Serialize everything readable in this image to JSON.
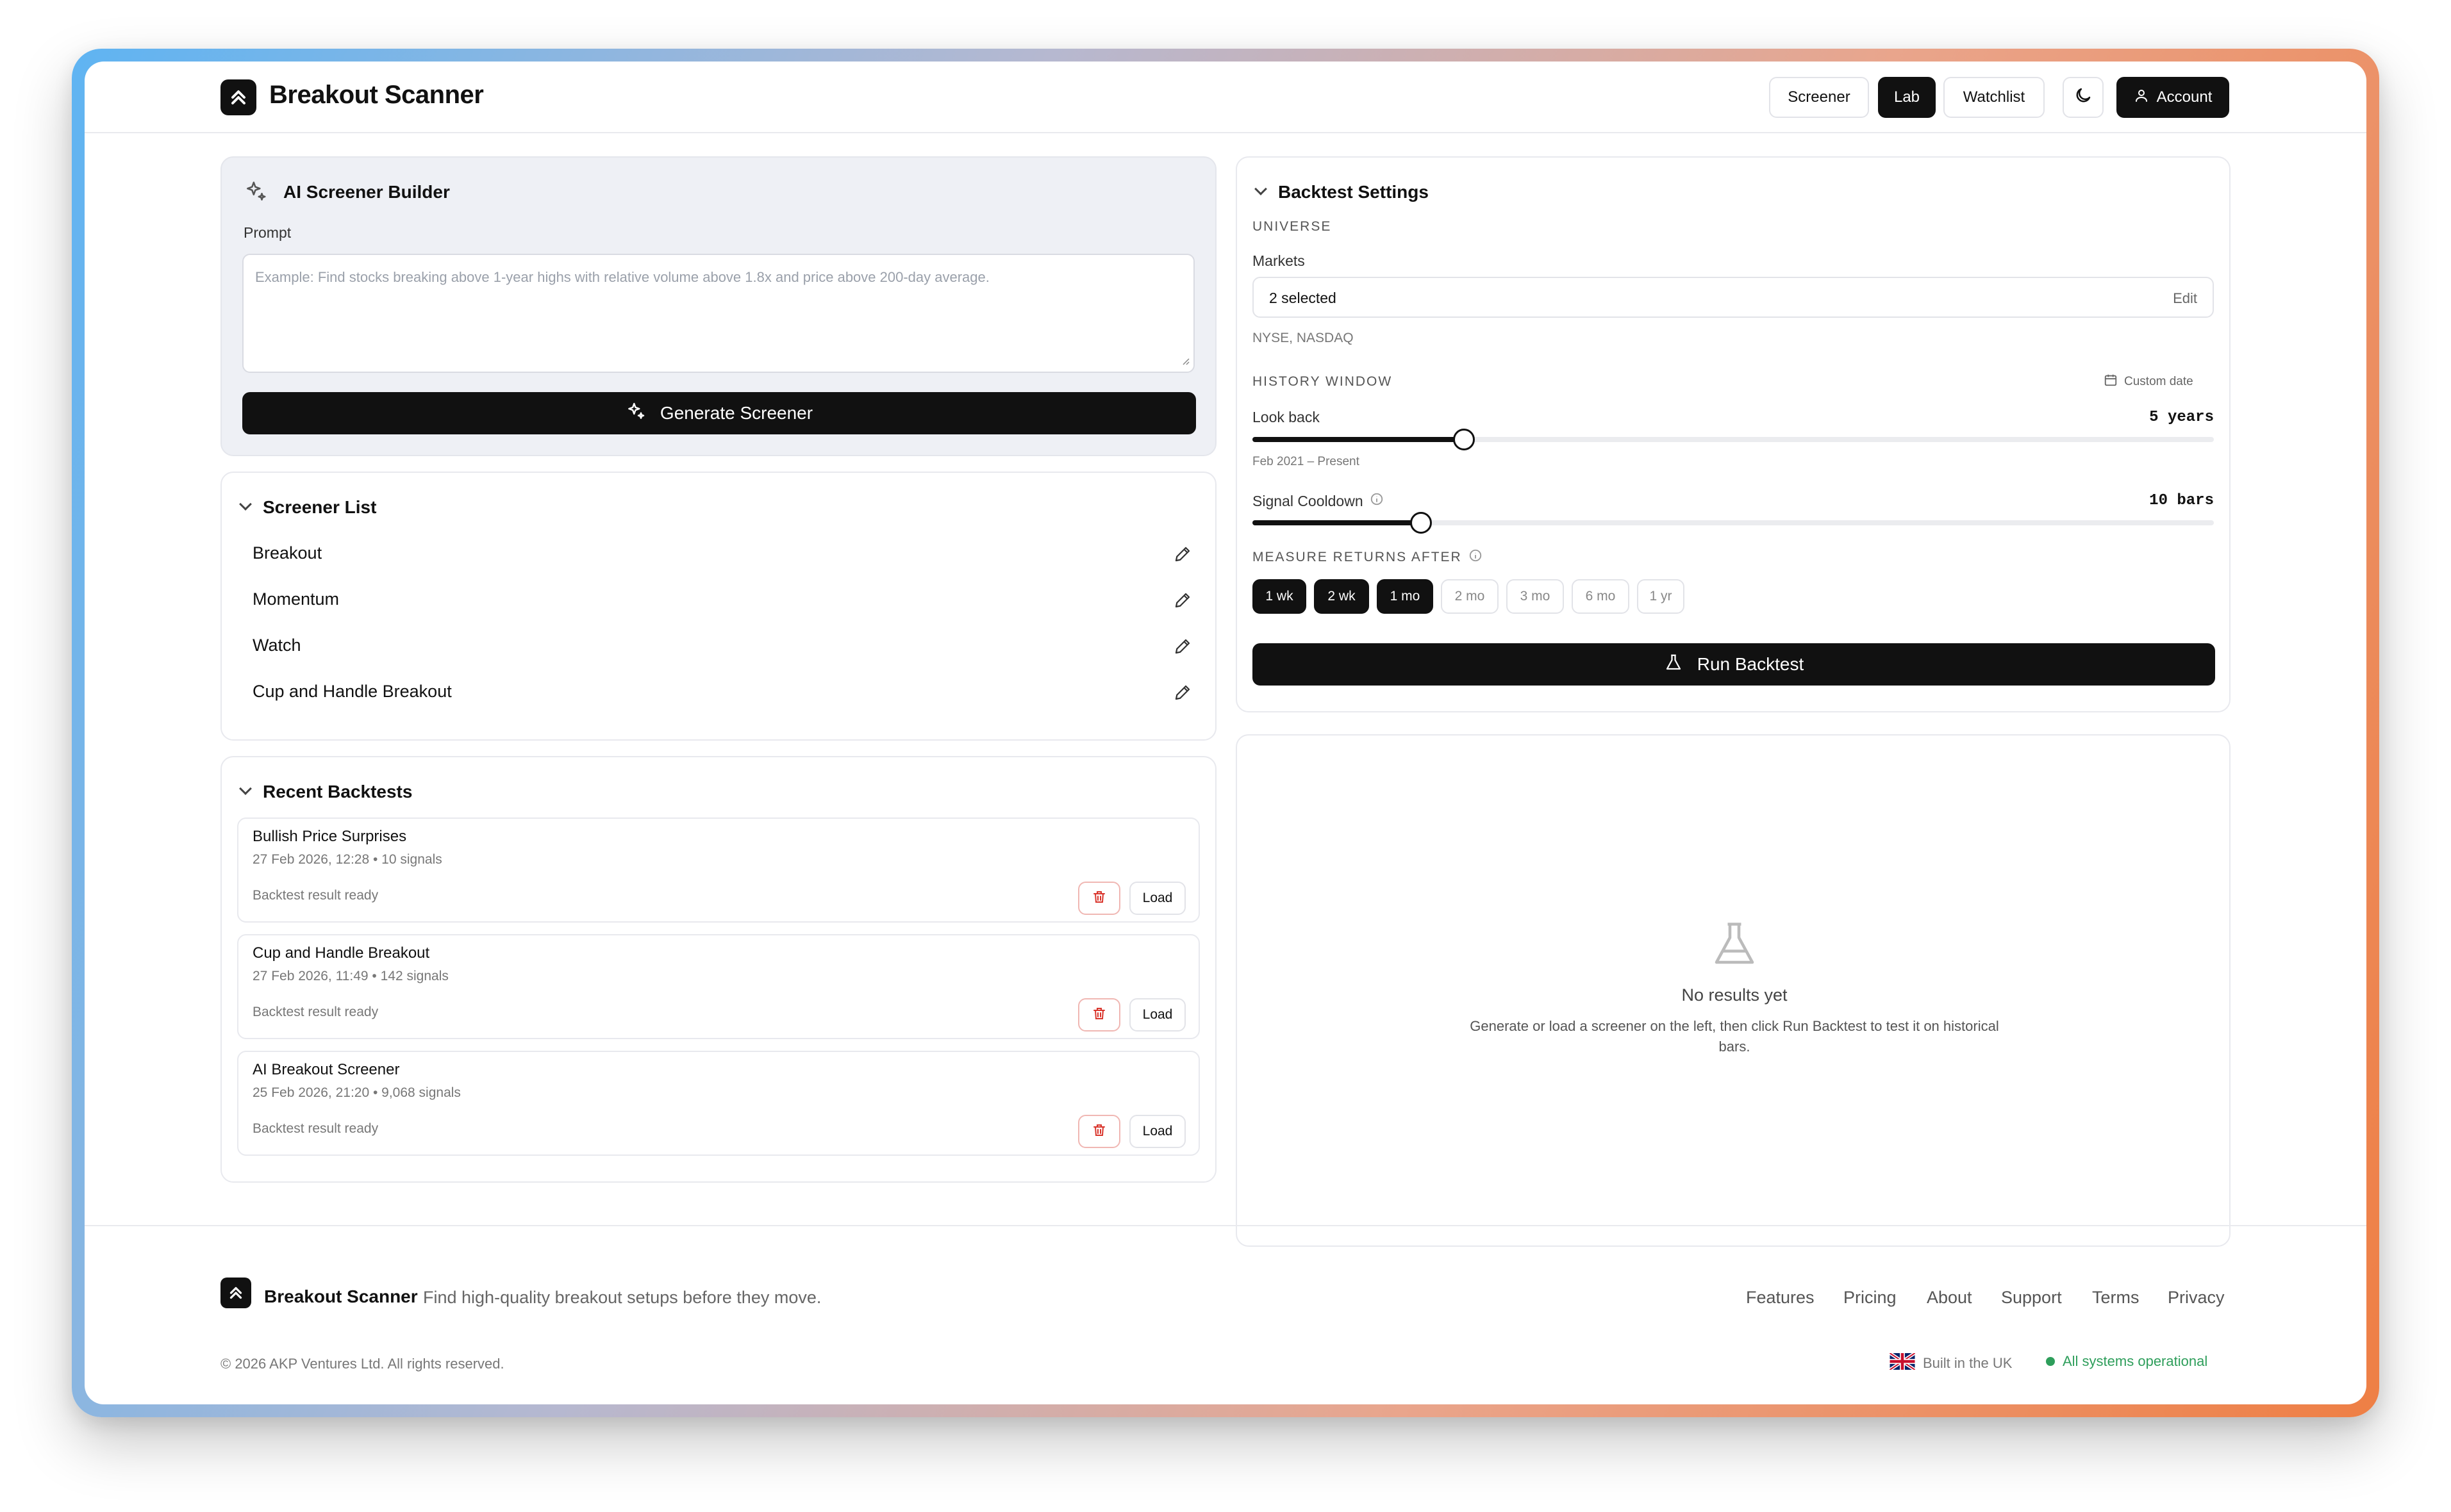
{
  "app": {
    "name": "Breakout Scanner"
  },
  "header": {
    "nav": [
      {
        "label": "Screener",
        "active": false
      },
      {
        "label": "Lab",
        "active": true
      },
      {
        "label": "Watchlist",
        "active": false
      }
    ],
    "theme_icon": "moon-icon",
    "account_label": "Account"
  },
  "ai_builder": {
    "title": "AI Screener Builder",
    "prompt_label": "Prompt",
    "prompt_value": "",
    "prompt_placeholder": "Example: Find stocks breaking above 1-year highs with relative volume above 1.8x and price above 200-day average.",
    "generate_label": "Generate Screener"
  },
  "screener_list": {
    "title": "Screener List",
    "items": [
      {
        "label": "Breakout"
      },
      {
        "label": "Momentum"
      },
      {
        "label": "Watch"
      },
      {
        "label": "Cup and Handle Breakout"
      }
    ]
  },
  "recent_backtests": {
    "title": "Recent Backtests",
    "load_label": "Load",
    "items": [
      {
        "title": "Bullish Price Surprises",
        "meta": "27 Feb 2026, 12:28 • 10 signals",
        "status": "Backtest result ready"
      },
      {
        "title": "Cup and Handle Breakout",
        "meta": "27 Feb 2026, 11:49 • 142 signals",
        "status": "Backtest result ready"
      },
      {
        "title": "AI Breakout Screener",
        "meta": "25 Feb 2026, 21:20 • 9,068 signals",
        "status": "Backtest result ready"
      }
    ]
  },
  "backtest_settings": {
    "title": "Backtest Settings",
    "universe_heading": "UNIVERSE",
    "markets_label": "Markets",
    "markets_value": "2 selected",
    "markets_edit": "Edit",
    "markets_list": "NYSE, NASDAQ",
    "history_heading": "HISTORY WINDOW",
    "custom_date_label": "Custom date",
    "lookback_label": "Look back",
    "lookback_value": "5 years",
    "lookback_fraction": 0.22,
    "lookback_range": "Feb 2021 – Present",
    "cooldown_label": "Signal Cooldown",
    "cooldown_value": "10 bars",
    "cooldown_fraction": 0.175,
    "measure_heading": "MEASURE RETURNS AFTER",
    "periods": [
      {
        "label": "1 wk",
        "selected": true
      },
      {
        "label": "2 wk",
        "selected": true
      },
      {
        "label": "1 mo",
        "selected": true
      },
      {
        "label": "2 mo",
        "selected": false
      },
      {
        "label": "3 mo",
        "selected": false
      },
      {
        "label": "6 mo",
        "selected": false
      },
      {
        "label": "1 yr",
        "selected": false
      }
    ],
    "run_label": "Run Backtest"
  },
  "results": {
    "title": "No results yet",
    "description": "Generate or load a screener on the left, then click Run Backtest to test it on historical bars."
  },
  "footer": {
    "brand": "Breakout Scanner",
    "tagline": "Find high-quality breakout setups before they move.",
    "links": [
      "Features",
      "Pricing",
      "About",
      "Support",
      "Terms",
      "Privacy"
    ],
    "copyright": "© 2026 AKP Ventures Ltd. All rights reserved.",
    "built_in": "Built in the UK",
    "status": "All systems operational",
    "status_color": "#2e9e5b"
  }
}
